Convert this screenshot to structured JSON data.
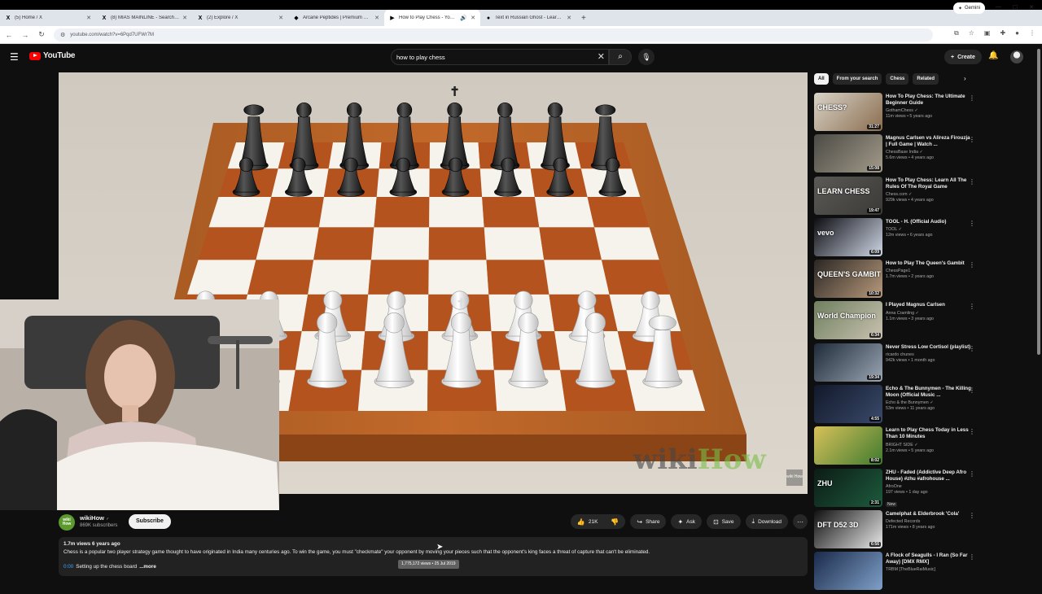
{
  "browser": {
    "tabs": [
      {
        "icon": "X",
        "title": "(5) Home / X"
      },
      {
        "icon": "X",
        "title": "(8) MIAS MAINLINE - Search / X"
      },
      {
        "icon": "X",
        "title": "(2) Explore / X"
      },
      {
        "icon": "◆",
        "title": "Arcane Peptides | Premium Re..."
      },
      {
        "icon": "▶",
        "title": "How to Play Chess - YouTube",
        "audio": "🔊",
        "active": true
      },
      {
        "icon": "●",
        "title": "Text in Russian Ghost - Learn R..."
      }
    ],
    "new_tab": "+",
    "gemini_label": "Gemini",
    "url": "youtube.com/watch?v=6Pqd7UFWr7M"
  },
  "youtube": {
    "logo_text": "YouTube",
    "search_value": "how to play chess",
    "create_label": "Create"
  },
  "video": {
    "watermark_dark": "wiki",
    "watermark_light": "How",
    "watermark_small": "wiki How"
  },
  "channel": {
    "avatar_text": "wiki How",
    "name": "wikiHow",
    "verified": "✓",
    "subscribers": "869K subscribers",
    "subscribe_label": "Subscribe"
  },
  "actions": {
    "likes": "21K",
    "share": "Share",
    "ask": "Ask",
    "save": "Save",
    "download": "Download"
  },
  "description": {
    "meta": "1.7m views  6 years ago",
    "body": "Chess is a popular two player strategy game thought to have originated in India many centuries ago. To win the game, you must \"checkmate\" your opponent by moving your pieces such that the opponent's king faces a threat of capture that can't be eliminated.",
    "chapter_time": "0:00",
    "chapter_title": "Setting up the chess board",
    "more": "...more",
    "tooltip": "1,775,172 views • 25 Jul 2019"
  },
  "chips": [
    "All",
    "From your search",
    "Chess",
    "Related"
  ],
  "recommendations": [
    {
      "title": "How To Play Chess: The Ultimate Beginner Guide",
      "channel": "GothamChess",
      "verified": true,
      "meta": "11m views • 5 years ago",
      "duration": "31:27",
      "thumb_text": "CHESS?",
      "colors": [
        "#d9d3c7",
        "#8a6d4f"
      ]
    },
    {
      "title": "Magnus Carlsen vs Alireza Firouzja | Full Game | Watch ...",
      "channel": "ChessBase India",
      "verified": true,
      "meta": "5.6m views • 4 years ago",
      "duration": "15:08",
      "thumb_text": "",
      "colors": [
        "#4b4a45",
        "#a39b8a"
      ]
    },
    {
      "title": "How To Play Chess: Learn All The Rules Of The Royal Game",
      "channel": "Chess.com",
      "verified": true,
      "meta": "929k views • 4 years ago",
      "duration": "19:47",
      "thumb_text": "LEARN CHESS",
      "colors": [
        "#5a5955",
        "#3b3a37"
      ]
    },
    {
      "title": "TOOL - H. (Official Audio)",
      "channel": "TOOL",
      "verified": true,
      "meta": "12m views • 6 years ago",
      "duration": "6:09",
      "thumb_text": "vevo",
      "colors": [
        "#0d0d12",
        "#cfd7e6"
      ]
    },
    {
      "title": "How to Play The Queen's Gambit",
      "channel": "ChessPage1",
      "verified": false,
      "meta": "1.7m views • 2 years ago",
      "duration": "10:32",
      "thumb_text": "QUEEN'S GAMBIT",
      "colors": [
        "#2a2623",
        "#b89a7c"
      ]
    },
    {
      "title": "I Played Magnus Carlsen",
      "channel": "Anna Cramling",
      "verified": true,
      "meta": "1.1m views • 3 years ago",
      "duration": "6:34",
      "thumb_text": "World Champion",
      "colors": [
        "#6f7f5f",
        "#c9c2b0"
      ]
    },
    {
      "title": "Never Stress Low Cortisol (playlist)",
      "channel": "ricardo chunes",
      "verified": false,
      "meta": "942k views • 1 month ago",
      "duration": "19:34",
      "thumb_text": "",
      "colors": [
        "#1f2a38",
        "#9aa6b3"
      ]
    },
    {
      "title": "Echo & The Bunnymen - The Killing Moon (Official Music ...",
      "channel": "Echo & the Bunnymen",
      "verified": true,
      "meta": "53m views • 11 years ago",
      "duration": "4:55",
      "thumb_text": "",
      "colors": [
        "#11182a",
        "#3a4a6a"
      ]
    },
    {
      "title": "Learn to Play Chess Today in Less Than 10 Minutes",
      "channel": "BRIGHT SIDE",
      "verified": true,
      "meta": "2.1m views • 5 years ago",
      "duration": "8:02",
      "thumb_text": "",
      "colors": [
        "#d8c15a",
        "#3f7b2f"
      ]
    },
    {
      "title": "ZHU - Faded (Addictive Deep Afro House) #zhu #afrohouse ...",
      "channel": "AfroOne",
      "verified": false,
      "meta": "197 views • 1 day ago",
      "duration": "2:31",
      "thumb_text": "ZHU",
      "badge": "New",
      "colors": [
        "#0c1c16",
        "#1d5a3c"
      ]
    },
    {
      "title": "Camelphat & Elderbrook 'Cola'",
      "channel": "Defected Records",
      "verified": false,
      "meta": "171m views • 8 years ago",
      "duration": "6:56",
      "thumb_text": "DFT D52 3D",
      "colors": [
        "#101010",
        "#e9e9e9"
      ]
    },
    {
      "title": "A Flock of Seagulls - I Ran (So Far Away) [DMX RMX]",
      "channel": "TRBM [TheBlueRaiMusic]",
      "verified": false,
      "meta": "",
      "duration": "",
      "thumb_text": "",
      "colors": [
        "#1a2a4a",
        "#7fa0c8"
      ]
    }
  ],
  "colors": {
    "yt_red": "#ff0000",
    "board_dark": "#b5531f",
    "board_light": "#f6f2ec"
  }
}
